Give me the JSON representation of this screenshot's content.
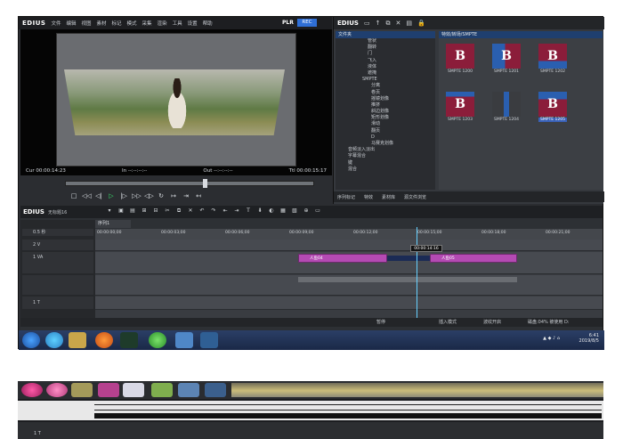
{
  "menubar": {
    "logo": "EDIUS",
    "items": [
      "文件",
      "编辑",
      "视图",
      "素材",
      "标记",
      "模式",
      "采集",
      "渲染",
      "工具",
      "设置",
      "帮助"
    ],
    "plr": "PLR",
    "rec": "REC"
  },
  "preview": {
    "timecodes": {
      "cur": "Cur 00:00:14:23",
      "in": "In --:--:--:--",
      "out": "Out --:--:--:--",
      "ttl": "Ttl 00:00:15:17"
    }
  },
  "transport_buttons": [
    "□",
    "◁◁",
    "◁|",
    "▷",
    "|▷",
    "▷▷",
    "◁▷",
    "↻",
    "↦",
    "⇥",
    "↤"
  ],
  "right_panel": {
    "logo": "EDIUS",
    "tree_header": "文件夹",
    "grid_header": "特效/转场/SMPTE",
    "tree_items": [
      "管状",
      "翻转",
      "门",
      "飞入",
      "液体",
      "遮掩",
      "SMPTE",
      "分离",
      "卷页",
      "摇镜划像",
      "推挤",
      "斜边划像",
      "矩形划像",
      "滑动",
      "翻页",
      "D",
      "马赛克划像",
      "音频淡入淡出",
      "字幕混合",
      "键",
      "混合"
    ],
    "thumbs": [
      {
        "label": "SMPTE 1200",
        "sel": false
      },
      {
        "label": "SMPTE 1201",
        "sel": false
      },
      {
        "label": "SMPTE 1202",
        "sel": false
      },
      {
        "label": "SMPTE 1203",
        "sel": false
      },
      {
        "label": "SMPTE 1204",
        "sel": false
      },
      {
        "label": "SMPTE 1205",
        "sel": true
      }
    ],
    "thumb_letter": "B",
    "tabs": [
      "序列标记",
      "特效",
      "素材库",
      "源文件浏览"
    ]
  },
  "timeline": {
    "logo": "EDIUS",
    "project": "无标题16",
    "sequence": "序列1",
    "tracks": [
      "",
      "2 V",
      "1 VA",
      "",
      "1 T"
    ],
    "zoom": "0.5 秒",
    "ruler": [
      "00:00:00;00",
      "00:00:03;00",
      "00:00:06;00",
      "00:00:09;00",
      "00:00:12;00",
      "00:00:15;00",
      "00:00:18;00",
      "00:00:21;00"
    ],
    "clips": [
      {
        "label": "人鱼04"
      },
      {
        "label": "人鱼05"
      }
    ],
    "cursor_time": "00:00:14:16",
    "status": {
      "pause": "暂停",
      "insert": "插入模式",
      "ripple": "波纹开启",
      "disk": "磁盘:04% 被使用 D:"
    }
  },
  "taskbar": {
    "time": "6:41",
    "date": "2019/8/5"
  },
  "bottom": {
    "label": "1 T"
  },
  "colors": {
    "accent": "#2f6fd6",
    "clip": "#b44ab3",
    "thumb_red": "#8b1d3a",
    "thumb_blue": "#2a5fb0"
  }
}
